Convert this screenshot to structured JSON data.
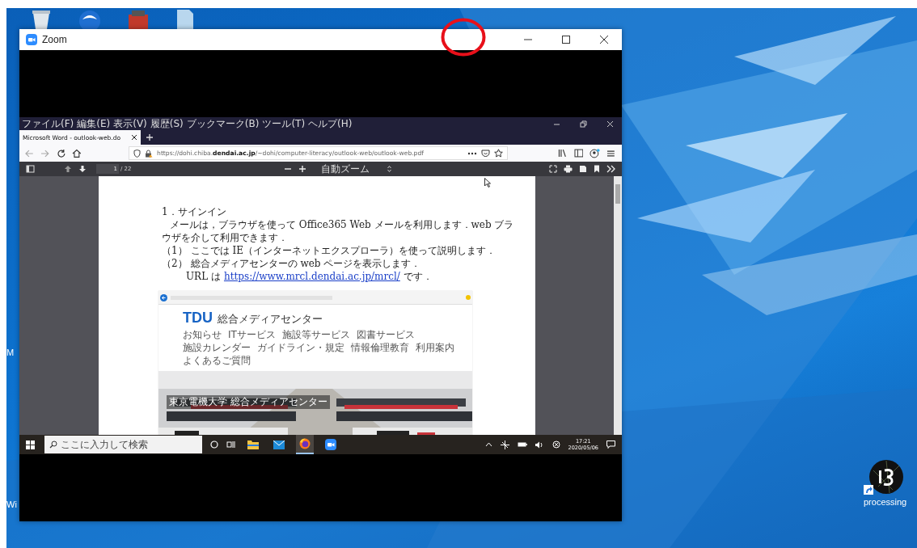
{
  "desktop": {
    "icons": [
      {
        "label": "M",
        "kind": "cut"
      },
      {
        "label": "Wi",
        "kind": "cut"
      },
      {
        "label": "processing",
        "kind": "shortcut"
      }
    ]
  },
  "zoom_window": {
    "title": "Zoom"
  },
  "browser": {
    "menu": [
      "ファイル(F)",
      "編集(E)",
      "表示(V)",
      "履歴(S)",
      "ブックマーク(B)",
      "ツール(T)",
      "ヘルプ(H)"
    ],
    "tabs": [
      {
        "title": "Microsoft Word - outlook-web.do",
        "selected": true
      }
    ],
    "url": "https://dohi.chiba.**dendai.ac.jp**/~dohi/computer-literacy/outlook-web/outlook-web.pdf",
    "pdf_toolbar": {
      "page": "1",
      "page_count": "/ 22",
      "zoom": "自動ズーム"
    }
  },
  "document": {
    "heading": "1．サインイン",
    "paragraph": "メールは，ブラウザを使って Office365 Web メールを利用します．web ブラウザを介して利用できます．",
    "items": [
      {
        "number": "（1）",
        "text": "ここでは IE（インターネットエクスプローラ）を使って説明します．"
      },
      {
        "number": "（2）",
        "text": "総合メディアセンターの web ページを表示します．"
      }
    ],
    "url_line": {
      "prefix": "URL は",
      "link": "https://www.mrcl.dendai.ac.jp/mrcl/",
      "suffix": "です．"
    },
    "screenshot": {
      "logo": "TDU",
      "site_title": "総合メディアセンター",
      "nav": [
        "お知らせ",
        "ITサービス",
        "施設等サービス",
        "図書サービス",
        "施設カレンダー",
        "ガイドライン・規定",
        "情報倫理教育",
        "利用案内",
        "よくあるご質問"
      ],
      "caption": "東京電機大学 総合メディアセンター"
    }
  },
  "taskbar": {
    "search_placeholder": "ここに入力して検索",
    "apps": [
      {
        "kind": "explorer",
        "selected": false
      },
      {
        "kind": "mail",
        "selected": false
      },
      {
        "kind": "firefox",
        "selected": true
      },
      {
        "kind": "zoom",
        "selected": false
      }
    ],
    "time": "17:21",
    "date": "2020/05/06"
  }
}
